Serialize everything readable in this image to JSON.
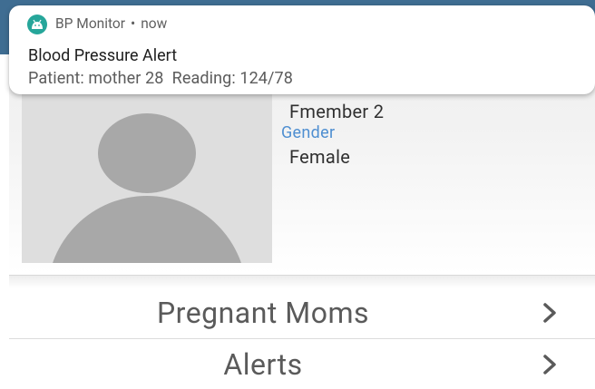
{
  "notification": {
    "app_name": "BP Monitor",
    "separator": "•",
    "time": "now",
    "title": "Blood Pressure Alert",
    "text": "Patient: mother 28  Reading: 124/78",
    "icon": "android-app-icon",
    "icon_color": "#26a69a"
  },
  "profile": {
    "name": "Fmember 2",
    "gender_label": "Gender",
    "gender_value": "Female",
    "avatar": "default-user-avatar"
  },
  "menu": {
    "items": [
      {
        "label": "Pregnant Moms",
        "icon": "chevron-right-icon"
      },
      {
        "label": "Alerts",
        "icon": "chevron-right-icon"
      }
    ]
  },
  "colors": {
    "app_bar": "#3f6d92",
    "accent_label": "#4f8fd1"
  }
}
